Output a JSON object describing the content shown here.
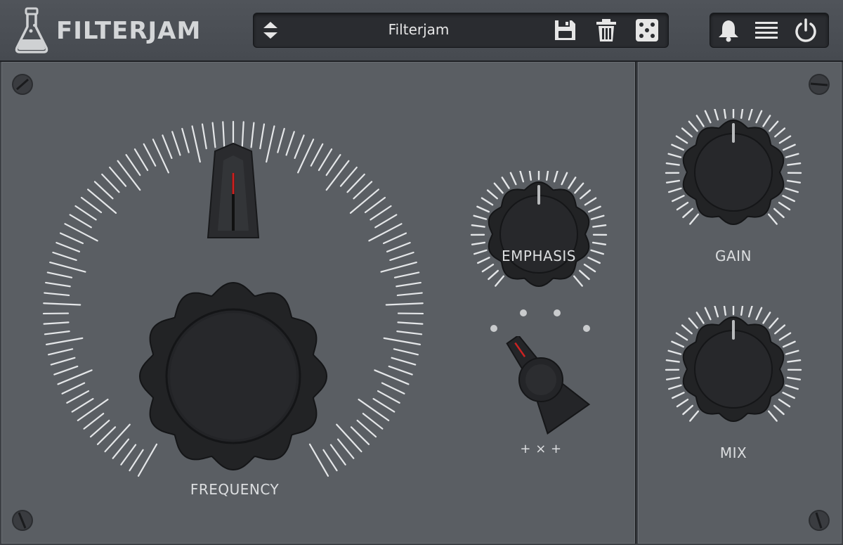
{
  "header": {
    "brand": "FILTERJAM",
    "preset": {
      "name": "Filterjam"
    },
    "icons": {
      "logo": "flask-icon",
      "preset_nav": "up-down-arrows-icon",
      "save": "floppy-disk-icon",
      "delete": "trash-icon",
      "random": "dice-icon",
      "notifications": "bell-icon",
      "menu": "hamburger-menu-icon",
      "power": "power-icon"
    }
  },
  "controls": {
    "frequency": {
      "label": "FREQUENCY"
    },
    "emphasis": {
      "label": "EMPHASIS"
    },
    "mode_switch": {
      "label": "+ × +",
      "positions": 4
    },
    "gain": {
      "label": "GAIN"
    },
    "mix": {
      "label": "MIX"
    }
  },
  "colors": {
    "panel": "#5a5e63",
    "header": "#4a4e54",
    "knob": "#222325",
    "tick": "#e4e6e8",
    "indicator": "#cc2222"
  }
}
